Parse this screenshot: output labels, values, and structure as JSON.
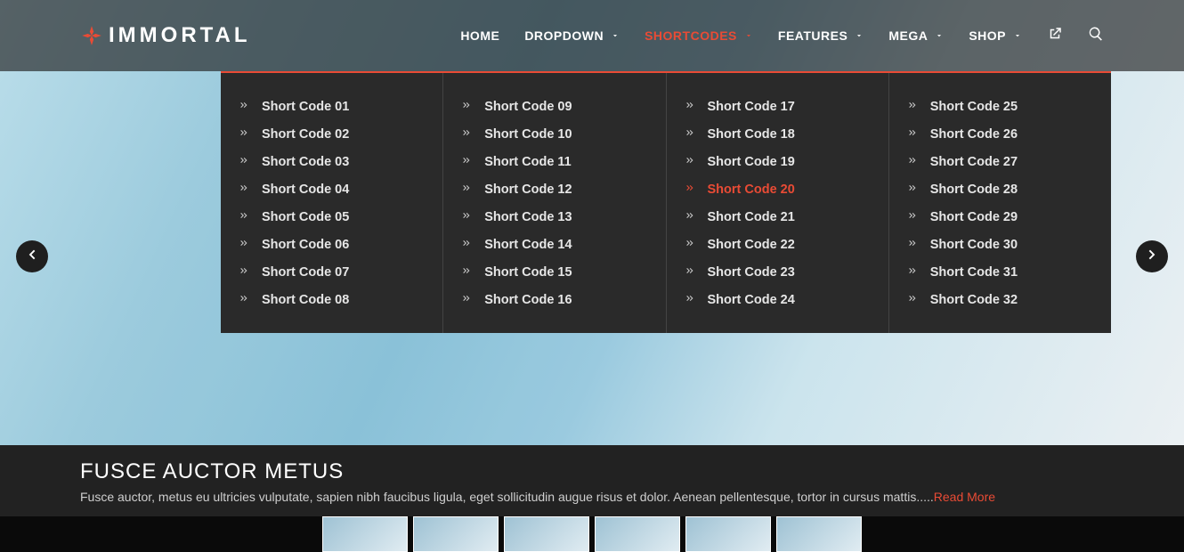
{
  "brand": {
    "name": "IMMORTAL",
    "accent": "#e94b35"
  },
  "nav": {
    "items": [
      {
        "label": "HOME",
        "dropdown": false
      },
      {
        "label": "DROPDOWN",
        "dropdown": true
      },
      {
        "label": "SHORTCODES",
        "dropdown": true,
        "active": true
      },
      {
        "label": "FEATURES",
        "dropdown": true
      },
      {
        "label": "MEGA",
        "dropdown": true
      },
      {
        "label": "SHOP",
        "dropdown": true
      }
    ]
  },
  "mega": {
    "cols": [
      [
        {
          "label": "Short Code 01"
        },
        {
          "label": "Short Code 02"
        },
        {
          "label": "Short Code 03"
        },
        {
          "label": "Short Code 04"
        },
        {
          "label": "Short Code 05"
        },
        {
          "label": "Short Code 06"
        },
        {
          "label": "Short Code 07"
        },
        {
          "label": "Short Code 08"
        }
      ],
      [
        {
          "label": "Short Code 09"
        },
        {
          "label": "Short Code 10"
        },
        {
          "label": "Short Code 11"
        },
        {
          "label": "Short Code 12"
        },
        {
          "label": "Short Code 13"
        },
        {
          "label": "Short Code 14"
        },
        {
          "label": "Short Code 15"
        },
        {
          "label": "Short Code 16"
        }
      ],
      [
        {
          "label": "Short Code 17"
        },
        {
          "label": "Short Code 18"
        },
        {
          "label": "Short Code 19"
        },
        {
          "label": "Short Code 20",
          "highlight": true
        },
        {
          "label": "Short Code 21"
        },
        {
          "label": "Short Code 22"
        },
        {
          "label": "Short Code 23"
        },
        {
          "label": "Short Code 24"
        }
      ],
      [
        {
          "label": "Short Code 25"
        },
        {
          "label": "Short Code 26"
        },
        {
          "label": "Short Code 27"
        },
        {
          "label": "Short Code 28"
        },
        {
          "label": "Short Code 29"
        },
        {
          "label": "Short Code 30"
        },
        {
          "label": "Short Code 31"
        },
        {
          "label": "Short Code 32"
        }
      ]
    ]
  },
  "hero": {
    "title": "FUSCE AUCTOR METUS",
    "text": "Fusce auctor, metus eu ultricies vulputate, sapien nibh faucibus ligula, eget sollicitudin augue risus et dolor. Aenean pellentesque, tortor in cursus mattis.....",
    "readmore": "Read More"
  },
  "thumbs": {
    "count": 6
  }
}
